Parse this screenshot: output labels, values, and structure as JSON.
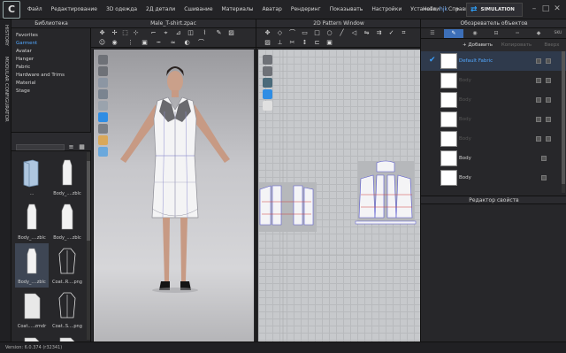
{
  "menu": {
    "logo": "C",
    "items": [
      "Файл",
      "Редактирование",
      "3D одежда",
      "2Д детали",
      "Сшивание",
      "Материалы",
      "Аватар",
      "Рендеринг",
      "Показывать",
      "Настройки",
      "Установки",
      "Справка"
    ],
    "greeting": "Hello,",
    "username": "hjk",
    "simulation_label": "SIMULATION"
  },
  "side_strip": {
    "history": "HISTORY",
    "modular": "MODULAR CONFIGURATOR"
  },
  "library": {
    "title": "Библиотека",
    "items": [
      "Favorites",
      "Garment",
      "Avatar",
      "Hanger",
      "Fabric",
      "Hardware and Trims",
      "Material",
      "Stage"
    ],
    "active_index": 1,
    "files": [
      {
        "caption": "..."
      },
      {
        "caption": "Body_....zblc"
      },
      {
        "caption": "Body_....zblc"
      },
      {
        "caption": "Body_....zblc"
      },
      {
        "caption": "Body_....zblc"
      },
      {
        "caption": "Coat..R....png"
      },
      {
        "caption": "Coat.....zmdr"
      },
      {
        "caption": "Coat..S....png"
      },
      {
        "caption": ""
      },
      {
        "caption": ""
      }
    ]
  },
  "window3d": {
    "title": "Male_T-shirt.zpac"
  },
  "window2d": {
    "title": "2D Pattern Window"
  },
  "right_panel": {
    "title": "Обозреватель объектов",
    "add_label": "+ Добавить",
    "copy_label": "Копировать",
    "extra_label": "Вверх",
    "sku_label": "SKU",
    "objects": [
      {
        "name": "Default Fabric",
        "selected": true
      },
      {
        "name": "Body",
        "selected": false
      },
      {
        "name": "Body",
        "selected": false
      },
      {
        "name": "Body",
        "selected": false
      },
      {
        "name": "Body",
        "selected": false
      },
      {
        "name": "Body",
        "selected": false
      },
      {
        "name": "Body",
        "selected": false
      }
    ],
    "props_title": "Редактор свойств"
  },
  "status": {
    "version": "Version: 6.0.374 (r32341)"
  },
  "colors": {
    "accent": "#3d6fb8",
    "link": "#52a8ff",
    "check": "#3aa0ff",
    "bg": "#1c1c1e"
  }
}
